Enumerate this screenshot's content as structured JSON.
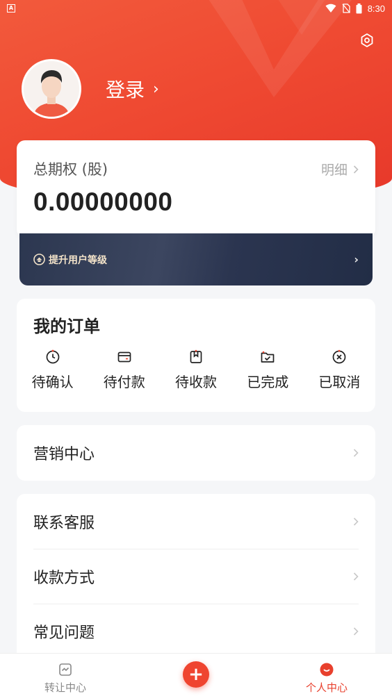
{
  "status_bar": {
    "time": "8:30"
  },
  "header": {
    "login_label": "登录",
    "login_chevron": "›"
  },
  "equity": {
    "title": "总期权 (股)",
    "detail_label": "明细",
    "value": "0.00000000"
  },
  "upgrade": {
    "label": "提升用户等级",
    "chevron": "›"
  },
  "orders": {
    "title": "我的订单",
    "items": [
      {
        "label": "待确认",
        "icon": "clock-icon"
      },
      {
        "label": "待付款",
        "icon": "wallet-icon"
      },
      {
        "label": "待收款",
        "icon": "bookmark-box-icon"
      },
      {
        "label": "已完成",
        "icon": "folder-check-icon"
      },
      {
        "label": "已取消",
        "icon": "circle-x-icon"
      }
    ]
  },
  "menu": {
    "marketing": "营销中心",
    "support": "联系客服",
    "payment": "收款方式",
    "faq": "常见问题"
  },
  "bottom_nav": {
    "transfer": "转让中心",
    "add": "+",
    "profile": "个人中心"
  },
  "colors": {
    "brand_red": "#ef4530",
    "upgrade_dark": "#2c3750",
    "upgrade_text": "#f3e3c9"
  }
}
